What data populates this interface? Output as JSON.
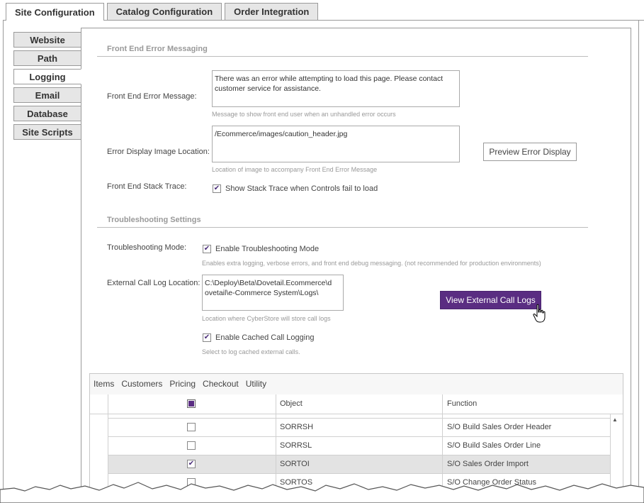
{
  "top_tabs": [
    {
      "label": "Site Configuration"
    },
    {
      "label": "Catalog Configuration"
    },
    {
      "label": "Order Integration"
    }
  ],
  "side_tabs": [
    {
      "label": "Website"
    },
    {
      "label": "Path"
    },
    {
      "label": "Logging"
    },
    {
      "label": "Email"
    },
    {
      "label": "Database"
    },
    {
      "label": "Site Scripts"
    }
  ],
  "front_end": {
    "section_title": "Front End Error Messaging",
    "error_message_label": "Front End Error Message:",
    "error_message_value": "There was an error while attempting to load this page. Please contact\ncustomer service for assistance.",
    "error_message_hint": "Message to show front end user when an unhandled error occurs",
    "image_location_label": "Error Display Image Location:",
    "image_location_value": "/Ecommerce/images/caution_header.jpg",
    "image_location_hint": "Location of image to accompany Front End Error Message",
    "preview_button": "Preview Error Display",
    "stack_trace_label": "Front End Stack Trace:",
    "stack_trace_checkbox": "Show Stack Trace when Controls fail to load",
    "stack_trace_checked": true
  },
  "troubleshooting": {
    "section_title": "Troubleshooting Settings",
    "mode_label": "Troubleshooting Mode:",
    "mode_checkbox": "Enable Troubleshooting Mode",
    "mode_checked": true,
    "mode_hint": "Enables extra logging, verbose errors, and front end debug messaging. (not recommended for production environments)",
    "call_log_label": "External Call Log Location:",
    "call_log_value": "C:\\Deploy\\Beta\\Dovetail.Ecommerce\\d\novetail\\e-Commerce System\\Logs\\",
    "call_log_hint": "Location where CyberStore will store call logs",
    "view_logs_button": "View External Call Logs",
    "cached_checkbox": "Enable Cached Call Logging",
    "cached_checked": true,
    "cached_hint": "Select to log cached external calls."
  },
  "grid": {
    "menu": [
      "Items",
      "Customers",
      "Pricing",
      "Checkout",
      "Utility"
    ],
    "headers": {
      "object": "Object",
      "function": "Function"
    },
    "rows": [
      {
        "object": "SORRSH",
        "function": "S/O Build Sales Order Header",
        "checked": false
      },
      {
        "object": "SORRSL",
        "function": "S/O Build Sales Order Line",
        "checked": false
      },
      {
        "object": "SORTOI",
        "function": "S/O Sales Order Import",
        "checked": true
      },
      {
        "object": "SORTOS",
        "function": "S/O Change Order Status",
        "checked": false
      }
    ]
  },
  "colors": {
    "accent": "#5a2d82",
    "check": "#4a2d7a"
  }
}
